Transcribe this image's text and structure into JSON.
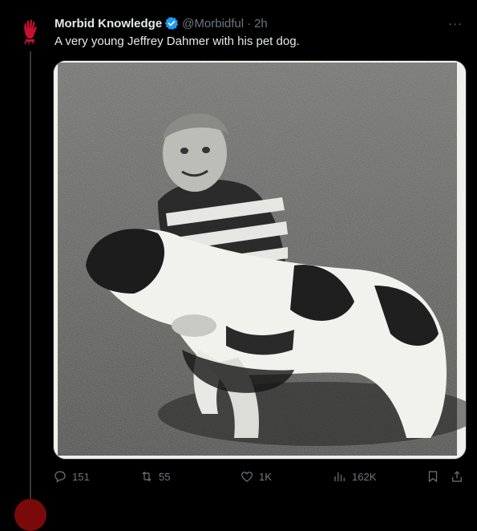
{
  "tweet": {
    "author_name": "Morbid Knowledge",
    "handle": "@Morbidful",
    "separator": "·",
    "time": "2h",
    "text": "A very young Jeffrey Dahmer with his pet dog.",
    "more_label": "···"
  },
  "media": {
    "alt": "Black-and-white photo of a young boy in a striped shirt holding a spotted dog on a lawn"
  },
  "actions": {
    "replies": "151",
    "retweets": "55",
    "likes": "1K",
    "views": "162K"
  },
  "icons": {
    "avatar": "red-handprint-avatar",
    "verified": "verified-badge-icon",
    "more": "more-icon",
    "reply": "reply-icon",
    "retweet": "retweet-icon",
    "like": "heart-icon",
    "views": "views-icon",
    "bookmark": "bookmark-icon",
    "share": "share-icon"
  },
  "colors": {
    "background": "#000000",
    "text": "#e7e9ea",
    "muted": "#71767b",
    "verified": "#1d9bf0",
    "avatar_accent": "#c8102e"
  }
}
